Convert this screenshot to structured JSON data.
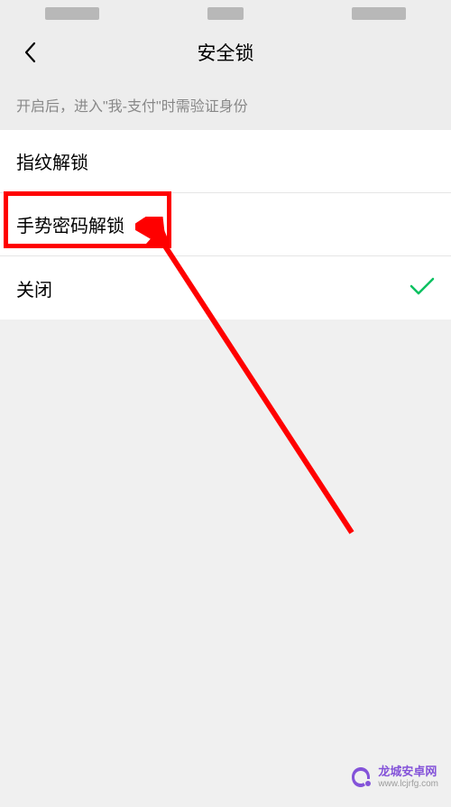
{
  "statusBar": {
    "left": "",
    "center": "",
    "right": ""
  },
  "header": {
    "title": "安全锁"
  },
  "sectionHint": "开启后，进入\"我-支付\"时需验证身份",
  "options": [
    {
      "label": "指纹解锁",
      "selected": false
    },
    {
      "label": "手势密码解锁",
      "selected": false
    },
    {
      "label": "关闭",
      "selected": true
    }
  ],
  "watermark": {
    "cn": "龙城安卓网",
    "url": "www.lcjrfg.com"
  }
}
